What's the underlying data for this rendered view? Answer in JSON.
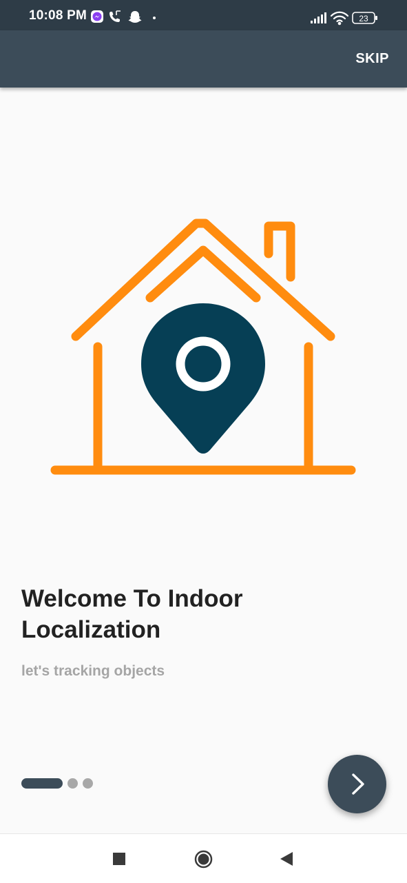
{
  "status_bar": {
    "time": "10:08 PM",
    "notification_icons": [
      "messenger-icon",
      "phone-call-icon",
      "snapchat-icon",
      "dot-icon"
    ],
    "system_icons": [
      "signal-icon",
      "wifi-icon",
      "battery-icon"
    ],
    "battery_level": "23"
  },
  "app_bar": {
    "skip_label": "SKIP"
  },
  "onboarding": {
    "illustration": "house-location-pin-icon",
    "title": "Welcome To Indoor Localization",
    "subtitle": "let's tracking objects",
    "page_indicator": {
      "total": 3,
      "active_index": 0
    },
    "next_icon": "chevron-right-icon"
  },
  "nav_bar": {
    "buttons": [
      "recents-square-icon",
      "home-circle-icon",
      "back-triangle-icon"
    ]
  },
  "colors": {
    "status_bar": "#2e3c47",
    "app_bar": "#3c4c59",
    "house_orange": "#ff8c0f",
    "pin_navy": "#063f55",
    "title_text": "#222222",
    "subtitle_text": "#a5a5a5"
  }
}
